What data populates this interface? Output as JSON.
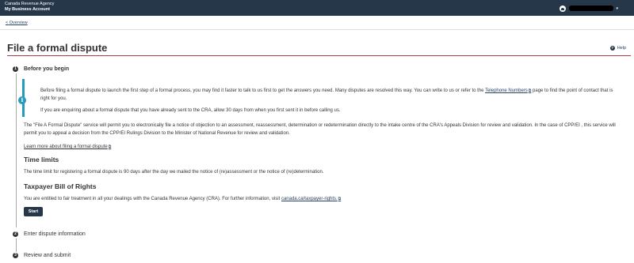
{
  "header": {
    "agency": "Canada Revenue Agency",
    "account": "My Business Account"
  },
  "breadcrumb": {
    "label": "Overview"
  },
  "page": {
    "title": "File a formal dispute",
    "help_label": "Help"
  },
  "steps": [
    {
      "number": "1",
      "title": "Before you begin",
      "active": true
    },
    {
      "number": "2",
      "title": "Enter dispute information",
      "active": false
    },
    {
      "number": "3",
      "title": "Review and submit",
      "active": false
    }
  ],
  "info": {
    "p1_text": "Before filing a formal dispute to launch the first step of a formal process, you may find it faster to talk to us first to get the answers you need. Many disputes are resolved this way. You can write to us or refer to the",
    "p1_link": "Telephone Numbers",
    "p1_tail": "page to find the point of contact that is right for you.",
    "p2": "If you are enquiring about a formal dispute that you have already sent to the CRA, allow 30 days from when you first sent it in before calling us."
  },
  "body": {
    "service_text": "The \"File A Formal Dispute\" service will permit you to electronically file a notice of objection to an assessment, reassessment, determination or redetermination directly to the intake centre of the CRA's Appeals Division for review and validation. In the case of CPP/EI , this service will permit you to appeal a decision from the CPP/EI Rulings Division to the Minister of National Revenue for review and validation.",
    "learn_more": "Learn more about filing a formal dispute",
    "time_limits_heading": "Time limits",
    "time_limits_text": "The time limit for registering a formal dispute is 90 days after the day we mailed the notice of (re)assessment or the notice of (re)determination.",
    "rights_heading": "Taxpayer Bill of Rights",
    "rights_text": "You are entitled to fair treatment in all your dealings with the Canada Revenue Agency (CRA). For further information, visit",
    "rights_link": "canada.ca/taxpayer-rights.",
    "start_label": "Start"
  },
  "colors": {
    "header_bg": "#26374a",
    "accent_rule": "#af3c43",
    "info_border": "#269abc",
    "link": "#284162"
  }
}
